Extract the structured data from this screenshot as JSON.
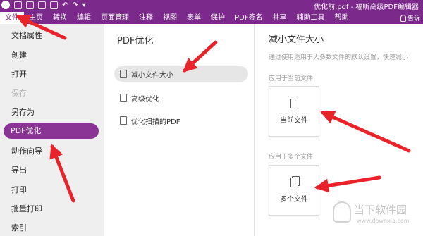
{
  "title_bar": {
    "icons": [
      "app-logo-icon",
      "save-icon",
      "open-icon",
      "mail-icon",
      "print-icon",
      "undo-icon",
      "redo-icon",
      "customize-icon"
    ],
    "title": "优化前.pdf - 福昕高级PDF编辑器"
  },
  "menu": {
    "items": [
      "文件",
      "主页",
      "转换",
      "编辑",
      "页面管理",
      "注释",
      "视图",
      "表单",
      "保护",
      "PDF签名",
      "共享",
      "辅助工具",
      "帮助"
    ],
    "active": "文件",
    "search_label": "告诉"
  },
  "sidebar": {
    "items": [
      {
        "label": "文档属性",
        "state": "normal"
      },
      {
        "label": "创建",
        "state": "normal"
      },
      {
        "label": "打开",
        "state": "normal"
      },
      {
        "label": "保存",
        "state": "disabled"
      },
      {
        "label": "另存为",
        "state": "normal"
      },
      {
        "label": "PDF优化",
        "state": "selected"
      },
      {
        "label": "动作向导",
        "state": "normal"
      },
      {
        "label": "导出",
        "state": "normal"
      },
      {
        "label": "打印",
        "state": "normal"
      },
      {
        "label": "批量打印",
        "state": "normal"
      },
      {
        "label": "索引",
        "state": "normal"
      }
    ]
  },
  "middle": {
    "header": "PDF优化",
    "options": [
      {
        "label": "减小文件大小",
        "icon": "reduce-size-icon",
        "selected": true
      },
      {
        "label": "高级优化",
        "icon": "advanced-optimize-icon",
        "selected": false
      },
      {
        "label": "优化扫描的PDF",
        "icon": "optimize-scan-icon",
        "selected": false
      }
    ]
  },
  "right": {
    "title": "减小文件大小",
    "description": "通过使用适用于大多数文件的默认设置，快速减小",
    "section_current": "应用于当前文件",
    "current_button": "当前文件",
    "section_multiple": "应用于多个文件",
    "multiple_button": "多个文件"
  },
  "watermark": {
    "text": "当下软件园",
    "url": "www.downxia.com"
  },
  "colors": {
    "brand_purple": "#7b2a8c",
    "selected_purple": "#8a3596",
    "annotation_red": "#e8232a"
  }
}
